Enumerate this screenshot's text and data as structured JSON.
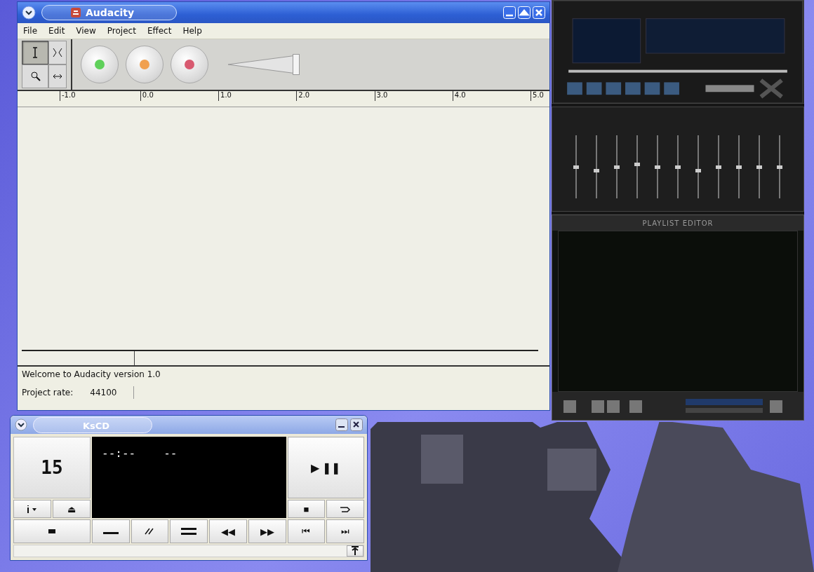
{
  "audacity": {
    "title": "Audacity",
    "menu": [
      "File",
      "Edit",
      "View",
      "Project",
      "Effect",
      "Help"
    ],
    "tools": [
      {
        "kind": "ibeam",
        "selected": true
      },
      {
        "kind": "envelope",
        "selected": false
      },
      {
        "kind": "zoom",
        "selected": false
      },
      {
        "kind": "timeshift",
        "selected": false
      }
    ],
    "transport": [
      {
        "kind": "play"
      },
      {
        "kind": "pause"
      },
      {
        "kind": "record"
      }
    ],
    "volume": {
      "level": 0.95
    },
    "ruler": [
      "-1.0",
      "0.0",
      "1.0",
      "2.0",
      "3.0",
      "4.0",
      "5.0"
    ],
    "status": "Welcome to Audacity version 1.0",
    "rate_label": "Project rate:",
    "rate_value": "44100"
  },
  "xmms": {
    "eq_bands": [
      {
        "level": 0.5
      },
      {
        "level": 0.45
      },
      {
        "level": 0.5
      },
      {
        "level": 0.55
      },
      {
        "level": 0.5
      },
      {
        "level": 0.5
      },
      {
        "level": 0.45
      },
      {
        "level": 0.5
      },
      {
        "level": 0.5
      },
      {
        "level": 0.5
      },
      {
        "level": 0.5
      }
    ],
    "playlist_title": "PLAYLIST EDITOR"
  },
  "kscd": {
    "title": "KsCD",
    "track": "15",
    "lcd": [
      "--:--",
      "--"
    ],
    "buttons": [
      {
        "kind": "play",
        "label": "▶ ❚❚"
      },
      {
        "kind": "stop",
        "label": "■"
      },
      {
        "kind": "eject",
        "label": "⏏"
      },
      {
        "kind": "rew",
        "label": "◀◀"
      },
      {
        "kind": "ff",
        "label": "▶▶"
      },
      {
        "kind": "prev",
        "label": "⏮"
      },
      {
        "kind": "next",
        "label": "⏭"
      }
    ]
  }
}
